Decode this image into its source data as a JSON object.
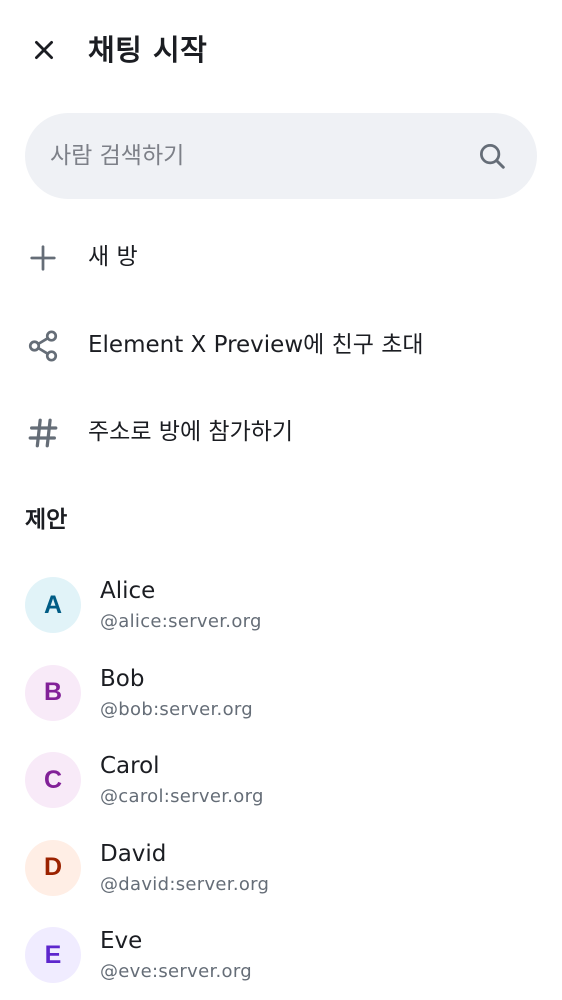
{
  "header": {
    "close_icon": "close-icon",
    "title": "채팅 시작"
  },
  "search": {
    "placeholder": "사람 검색하기",
    "value": "",
    "icon": "search-icon"
  },
  "actions": [
    {
      "icon": "plus-icon",
      "label": "새 방"
    },
    {
      "icon": "share-icon",
      "label": "Element X Preview에 친구 초대"
    },
    {
      "icon": "hash-icon",
      "label": "주소로 방에 참가하기"
    }
  ],
  "suggestions_title": "제안",
  "suggestions": [
    {
      "initial": "A",
      "name": "Alice",
      "user_id": "@alice:server.org",
      "avatar_bg": "#e1f3f8",
      "avatar_fg": "#005c85"
    },
    {
      "initial": "B",
      "name": "Bob",
      "user_id": "@bob:server.org",
      "avatar_bg": "#f8eaf8",
      "avatar_fg": "#822198"
    },
    {
      "initial": "C",
      "name": "Carol",
      "user_id": "@carol:server.org",
      "avatar_bg": "#f8eaf8",
      "avatar_fg": "#822198"
    },
    {
      "initial": "D",
      "name": "David",
      "user_id": "@david:server.org",
      "avatar_bg": "#ffeee5",
      "avatar_fg": "#9b2200"
    },
    {
      "initial": "E",
      "name": "Eve",
      "user_id": "@eve:server.org",
      "avatar_bg": "#f0ecff",
      "avatar_fg": "#5d26cd"
    }
  ],
  "colors": {
    "text_primary": "#1b1d22",
    "text_secondary": "#656d77",
    "search_bg": "#eff1f5",
    "icon": "#656d77"
  }
}
